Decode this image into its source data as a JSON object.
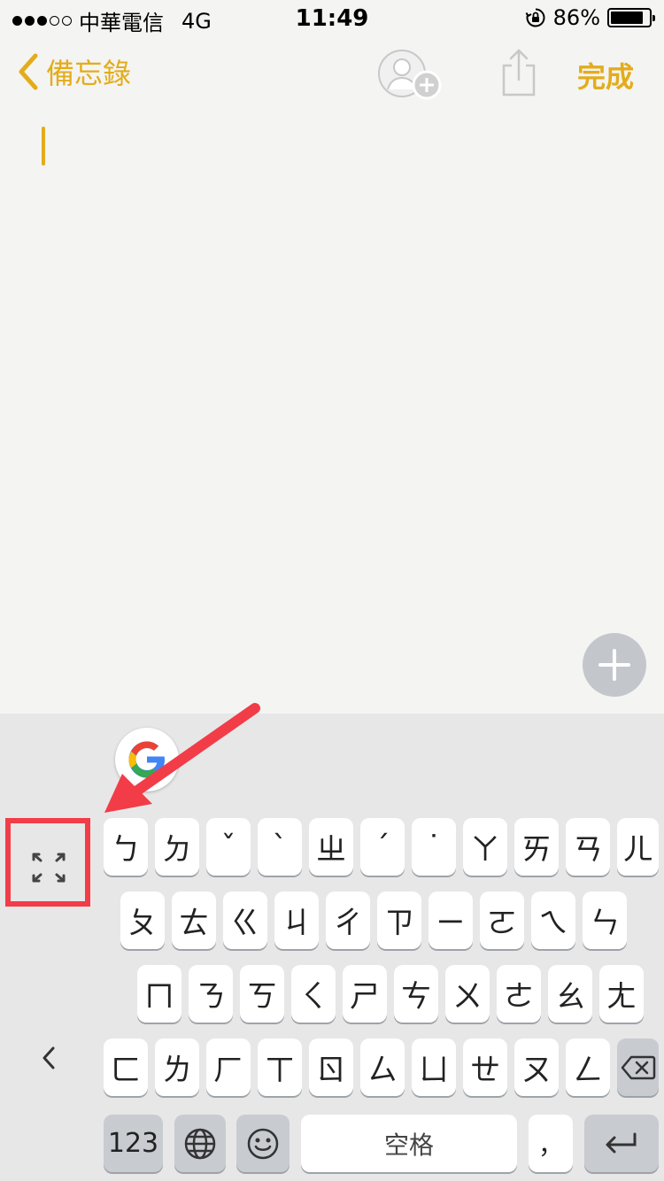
{
  "status_bar": {
    "signal_dots": [
      true,
      true,
      true,
      false,
      false
    ],
    "carrier": "中華電信",
    "network": "4G",
    "time": "11:49",
    "battery_percent": "86%",
    "battery_level": 0.86,
    "orientation_lock_icon": "rotation-lock-icon"
  },
  "nav": {
    "back_label": "備忘錄",
    "done_label": "完成",
    "accent_color": "#e3ac1b",
    "icons": [
      "add-people-icon",
      "share-icon"
    ]
  },
  "note": {
    "text": "",
    "fab_icon": "plus-icon"
  },
  "keyboard": {
    "logo": "google-logo",
    "rows": [
      [
        "ㄅ",
        "ㄉ",
        "ˇ",
        "ˋ",
        "ㄓ",
        "ˊ",
        "˙",
        "ㄚ",
        "ㄞ",
        "ㄢ",
        "ㄦ"
      ],
      [
        "ㄆ",
        "ㄊ",
        "ㄍ",
        "ㄐ",
        "ㄔ",
        "ㄗ",
        "ㄧ",
        "ㄛ",
        "ㄟ",
        "ㄣ"
      ],
      [
        "ㄇ",
        "ㄋ",
        "ㄎ",
        "ㄑ",
        "ㄕ",
        "ㄘ",
        "ㄨ",
        "ㄜ",
        "ㄠ",
        "ㄤ"
      ],
      [
        "ㄈ",
        "ㄌ",
        "ㄏ",
        "ㄒ",
        "ㄖ",
        "ㄙ",
        "ㄩ",
        "ㄝ",
        "ㄡ",
        "ㄥ"
      ]
    ],
    "bottom": {
      "numbers_label": "123",
      "space_label": "空格",
      "comma_label": "，"
    },
    "icons": [
      "expand-icon",
      "chevron-left-icon",
      "backspace-icon",
      "globe-icon",
      "emoji-icon",
      "return-icon"
    ]
  },
  "annotation": {
    "color": "#f23c48"
  }
}
